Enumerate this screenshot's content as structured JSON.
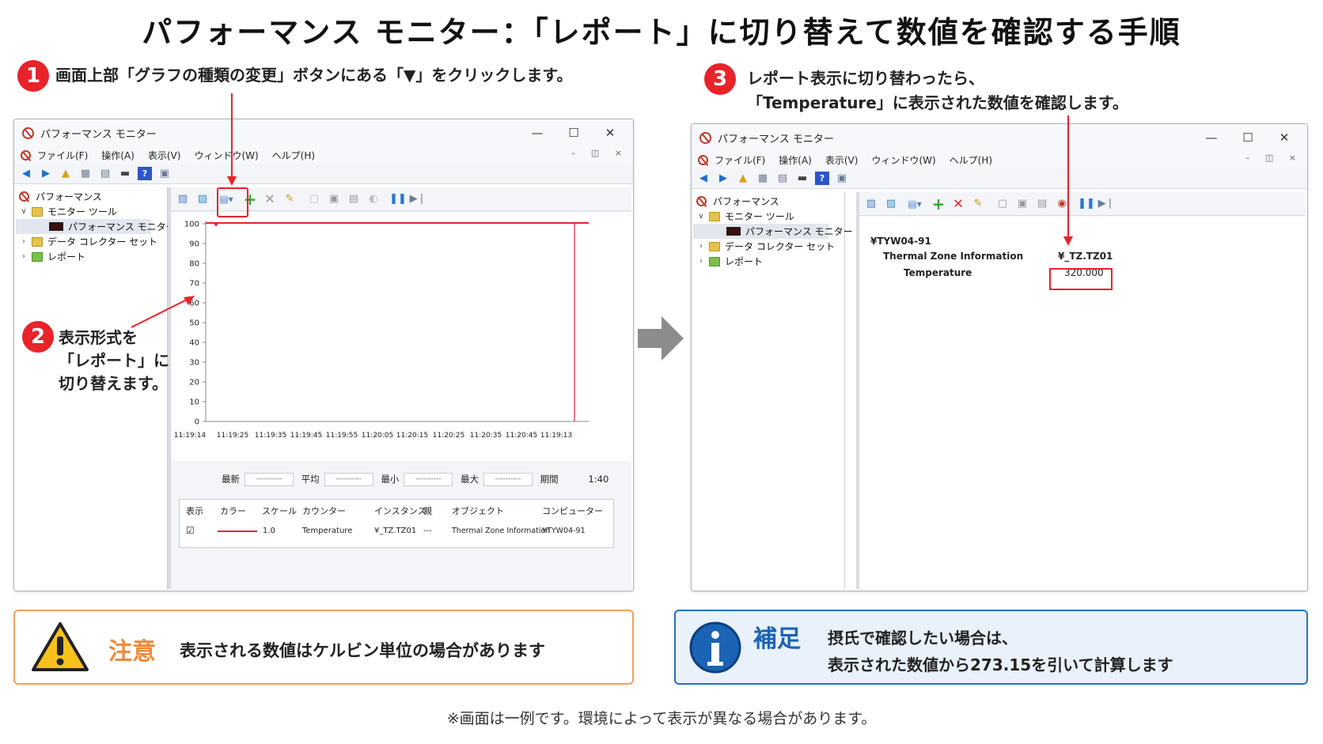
{
  "title": "パフォーマンス モニター：「レポート」に切り替えて数値を確認する手順",
  "step1": {
    "num": "1",
    "text": "画面上部「グラフの種類の変更」ボタンにある「▼」をクリックします。"
  },
  "step2": {
    "num": "2",
    "line1": "表示形式を",
    "line2": "「レポート」に",
    "line3": "切り替えます。"
  },
  "step3": {
    "num": "3",
    "line1": "レポート表示に切り替わったら、",
    "line2": "「Temperature」に表示された数値を確認します。"
  },
  "window": {
    "title": "パフォーマンス モニター",
    "menu": [
      "ファイル(F)",
      "操作(A)",
      "表示(V)",
      "ウィンドウ(W)",
      "ヘルプ(H)"
    ],
    "tree": {
      "root": "パフォーマンス",
      "monitor_tools": "モニター ツール",
      "perf_monitor": "パフォーマンス モニター",
      "dcs": "データ コレクター セット",
      "report": "レポート"
    },
    "controls": {
      "minimize": "—",
      "maximize": "☐",
      "close": "✕",
      "doc": "– ◫ ×"
    }
  },
  "graph": {
    "yticks": [
      "100",
      "90",
      "80",
      "70",
      "60",
      "50",
      "40",
      "30",
      "20",
      "10",
      "0"
    ],
    "xticks": [
      "11:19:14",
      "11:19:25",
      "11:19:35",
      "11:19:45",
      "11:19:55",
      "11:20:05",
      "11:20:15",
      "11:20:25",
      "11:20:35",
      "11:20:45",
      "11:19:13"
    ],
    "stats": {
      "last": "最新",
      "avg": "平均",
      "min": "最小",
      "max": "最大",
      "duration": "期間",
      "duration_value": "1:40",
      "placeholder": "----------"
    },
    "legend_headers": [
      "表示",
      "カラー",
      "スケール",
      "カウンター",
      "インスタンス",
      "親",
      "オブジェクト",
      "コンピューター"
    ],
    "legend_row": {
      "show": "☑",
      "scale": "1.0",
      "counter": "Temperature",
      "instance": "¥_TZ.TZ01",
      "parent": "---",
      "object": "Thermal Zone Information",
      "computer": "¥TYW04-91"
    }
  },
  "report": {
    "computer": "¥TYW04-91",
    "object": "Thermal Zone Information",
    "instance": "¥_TZ.TZ01",
    "counter": "Temperature",
    "value": "320.000"
  },
  "caution": {
    "label": "注意",
    "text": "表示される数値はケルビン単位の場合があります"
  },
  "supplement": {
    "label": "補足",
    "line1": "摂氏で確認したい場合は、",
    "line2": "表示された数値から273.15を引いて計算します"
  },
  "footnote": "※画面は一例です。環境によって表示が異なる場合があります。",
  "colors": {
    "accent_red": "#e8232a",
    "caution_orange": "#f08a3a",
    "info_blue": "#1a63b5",
    "series": "#e8232a"
  }
}
